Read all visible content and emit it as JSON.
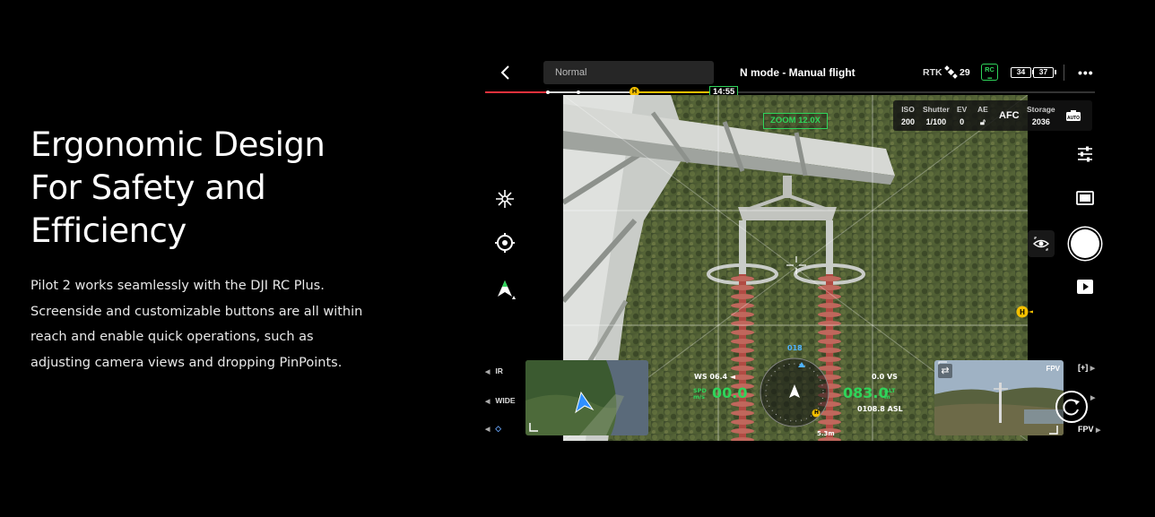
{
  "hero": {
    "title_lines": [
      "Ergonomic Design",
      "For Safety and",
      "Efficiency"
    ],
    "body": "Pilot 2 works seamlessly with the DJI RC Plus. Screenside and customizable buttons are all within reach and enable quick operations, such as adjusting camera views and dropping PinPoints."
  },
  "topbar": {
    "mode": "Normal",
    "flight_mode": "N mode - Manual flight",
    "rtk": "RTK",
    "satellites": "29",
    "rc_label": "RC",
    "battery_1": "34",
    "battery_2": "37",
    "more": "•••"
  },
  "timeline": {
    "home": "H",
    "remaining_time": "14:55"
  },
  "camera": {
    "zoom_label": "ZOOM 12.0X",
    "params": {
      "iso_label": "ISO",
      "iso": "200",
      "shutter_label": "Shutter",
      "shutter": "1/100",
      "ev_label": "EV",
      "ev": "0",
      "ae_label": "AE",
      "focus": "AFC",
      "storage_label": "Storage",
      "storage": "2036"
    }
  },
  "lenses": {
    "ir": "IR",
    "wide": "WIDE"
  },
  "telemetry": {
    "wind": "WS 06.4",
    "spd_label": "SPD",
    "spd_unit": "m/s",
    "speed": "00.0",
    "heading": "018",
    "altitude": "083.0",
    "alt_label": "ALT",
    "alt_unit": "m",
    "vs": "0.0 VS",
    "asl": "0108.8 ASL",
    "distance": "5.3m",
    "home": "H"
  },
  "pip": {
    "label": "FPV"
  },
  "right_rail": {
    "fpv_label": "FPV",
    "plus_box": "[+]"
  },
  "colors": {
    "accent_green": "#2fd45a",
    "home_yellow": "#f5c000",
    "timeline_red": "#e8313c"
  }
}
